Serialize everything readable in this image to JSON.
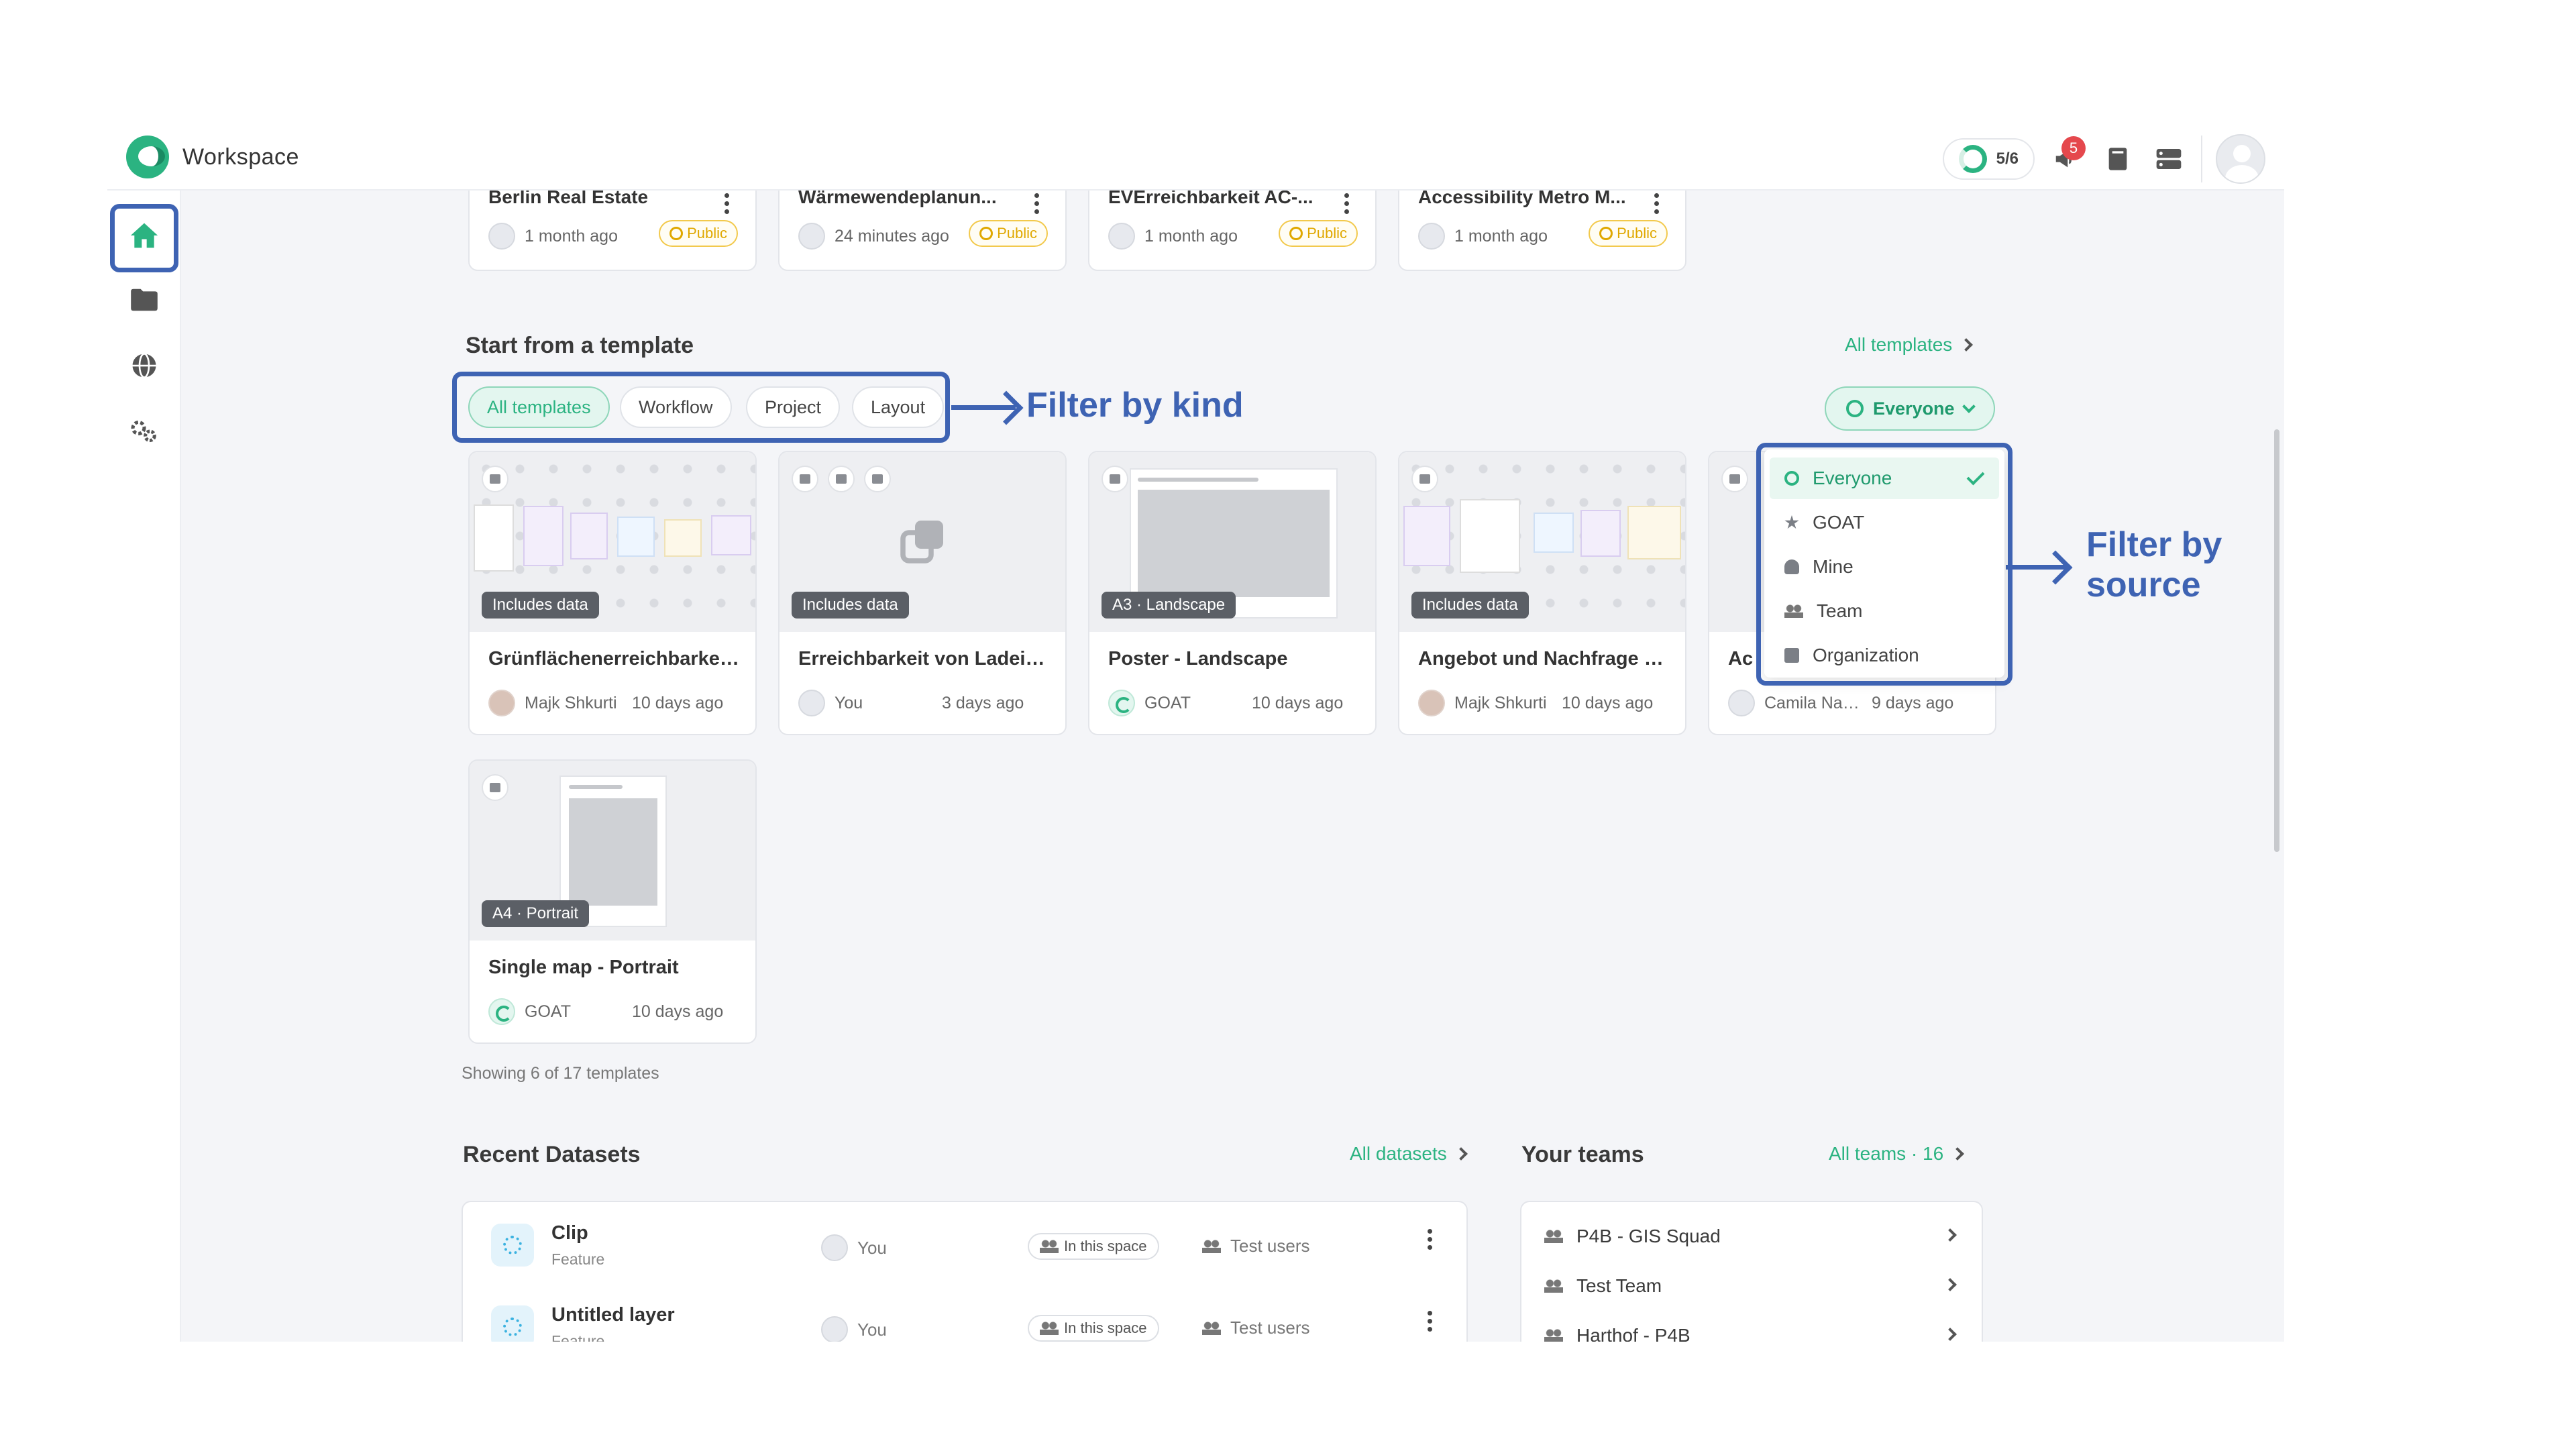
{
  "header": {
    "app_name": "Workspace",
    "progress_text": "5/6",
    "notification_count": "5"
  },
  "sidebar": {
    "items": [
      {
        "name": "home",
        "active": true
      },
      {
        "name": "folder",
        "active": false
      },
      {
        "name": "globe",
        "active": false
      },
      {
        "name": "settings",
        "active": false
      }
    ]
  },
  "projects": [
    {
      "title": "Berlin Real Estate",
      "time": "1 month ago",
      "visibility": "Public"
    },
    {
      "title": "Wärmewendeplanun...",
      "time": "24 minutes ago",
      "visibility": "Public"
    },
    {
      "title": "EVErreichbarkeit AC-...",
      "time": "1 month ago",
      "visibility": "Public"
    },
    {
      "title": "Accessibility Metro M...",
      "time": "1 month ago",
      "visibility": "Public"
    }
  ],
  "templates_section": {
    "title": "Start from a template",
    "all_link": "All templates",
    "filters": [
      "All templates",
      "Workflow",
      "Project",
      "Layout"
    ],
    "active_filter": "All templates",
    "source_button": "Everyone",
    "source_options": [
      "Everyone",
      "GOAT",
      "Mine",
      "Team",
      "Organization"
    ],
    "selected_source": "Everyone",
    "showing_text": "Showing 6 of 17 templates",
    "cards": [
      {
        "title": "Grünflächenerreichbarkeit ...",
        "badge": "Includes data",
        "author": "Majk Shkurti",
        "time": "10 days ago"
      },
      {
        "title": "Erreichbarkeit von Ladeinf...",
        "badge": "Includes data",
        "author": "You",
        "time": "3 days ago"
      },
      {
        "title": "Poster - Landscape",
        "badge": "A3 · Landscape",
        "author": "GOAT",
        "time": "10 days ago"
      },
      {
        "title": "Angebot und Nachfrage pr...",
        "badge": "Includes data",
        "author": "Majk Shkurti",
        "time": "10 days ago"
      },
      {
        "title": "Ac",
        "badge": "",
        "author": "Camila Narb...",
        "time": "9 days ago"
      },
      {
        "title": "Single map - Portrait",
        "badge": "A4 · Portrait",
        "author": "GOAT",
        "time": "10 days ago"
      }
    ]
  },
  "datasets_section": {
    "title": "Recent Datasets",
    "all_link": "All datasets",
    "rows": [
      {
        "name": "Clip",
        "type": "Feature",
        "owner": "You",
        "space": "In this space",
        "users": "Test users"
      },
      {
        "name": "Untitled layer",
        "type": "Feature",
        "owner": "You",
        "space": "In this space",
        "users": "Test users"
      }
    ]
  },
  "teams_section": {
    "title": "Your teams",
    "all_link": "All teams · 16",
    "teams": [
      "P4B - GIS Squad",
      "Test Team",
      "Harthof - P4B"
    ]
  },
  "annotations": {
    "filter_kind": "Filter by kind",
    "filter_source_line1": "Filter by",
    "filter_source_line2": "source"
  },
  "colors": {
    "brand": "#2bb381",
    "annotation": "#3e63b3",
    "public": "#e0a800"
  }
}
